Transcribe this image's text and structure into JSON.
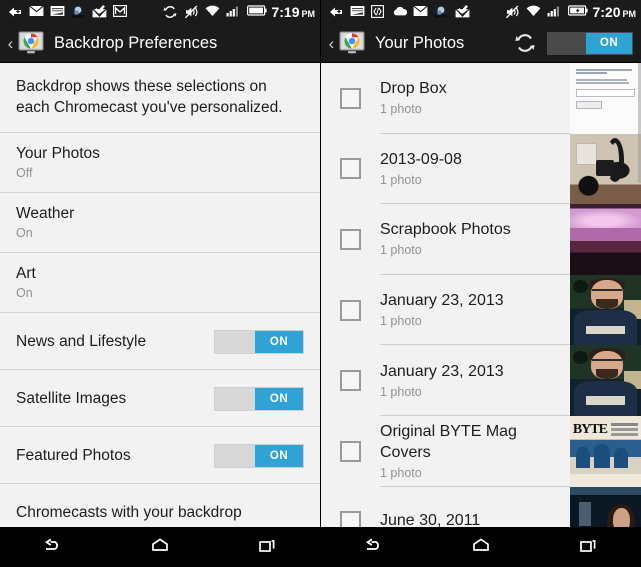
{
  "left": {
    "statusbar": {
      "time": "7:19",
      "ampm": "PM",
      "icons": [
        "download-arrow-icon",
        "envelope-icon",
        "mail-inbox-icon",
        "photo-icon",
        "check-envelope-icon",
        "gmail-m-icon"
      ],
      "right_icons": [
        "sync-rotate-icon",
        "mute-vibrate-icon",
        "wifi-icon",
        "cell-signal-icon",
        "battery-icon"
      ]
    },
    "actionbar": {
      "back_label": "‹",
      "app_icon": "chromecast-icon",
      "title": "Backdrop Preferences"
    },
    "intro": "Backdrop shows these selections on each Chromecast you've personalized.",
    "rows": [
      {
        "title": "Your Photos",
        "subtitle": "Off",
        "toggle": null
      },
      {
        "title": "Weather",
        "subtitle": "On",
        "toggle": null
      },
      {
        "title": "Art",
        "subtitle": "On",
        "toggle": null
      },
      {
        "title": "News and Lifestyle",
        "subtitle": "",
        "toggle": "ON"
      },
      {
        "title": "Satellite Images",
        "subtitle": "",
        "toggle": "ON"
      },
      {
        "title": "Featured Photos",
        "subtitle": "",
        "toggle": "ON"
      },
      {
        "title": "Chromecasts with your backdrop",
        "subtitle": "",
        "toggle": null
      }
    ],
    "navbar": {
      "back": "back-icon",
      "home": "home-icon",
      "recents": "recents-icon"
    }
  },
  "right": {
    "statusbar": {
      "time": "7:20",
      "ampm": "PM",
      "icons": [
        "download-arrow-icon",
        "mail-inbox-icon",
        "code-icon",
        "cloud-icon",
        "envelope-icon",
        "photo-icon",
        "check-envelope-icon"
      ],
      "right_icons": [
        "mute-vibrate-icon",
        "wifi-icon",
        "cell-signal-icon",
        "battery-charging-icon"
      ]
    },
    "actionbar": {
      "back_label": "‹",
      "app_icon": "chromecast-icon",
      "title": "Your Photos",
      "refresh_icon": "refresh-icon",
      "toggle_label": "ON"
    },
    "albums": [
      {
        "title": "Drop Box",
        "count": "1 photo",
        "checked": false,
        "thumb": "form"
      },
      {
        "title": "2013-09-08",
        "count": "1 photo",
        "checked": false,
        "thumb": "cables"
      },
      {
        "title": "Scrapbook Photos",
        "count": "1 photo",
        "checked": false,
        "thumb": "sky"
      },
      {
        "title": "January 23, 2013",
        "count": "1 photo",
        "checked": false,
        "thumb": "man"
      },
      {
        "title": "January 23, 2013",
        "count": "1 photo",
        "checked": false,
        "thumb": "man"
      },
      {
        "title": "Original BYTE Mag Covers",
        "count": "1 photo",
        "checked": false,
        "thumb": "byte"
      },
      {
        "title": "June 30, 2011",
        "count": "",
        "checked": false,
        "thumb": "woman"
      }
    ],
    "navbar": {
      "back": "back-icon",
      "home": "home-icon",
      "recents": "recents-icon"
    }
  },
  "colors": {
    "accent_blue": "#2fa3d4",
    "status_bg": "#1b1b1b",
    "list_bg": "#f2f2f2",
    "text_primary": "#1d1d1d",
    "text_secondary": "#939393"
  }
}
